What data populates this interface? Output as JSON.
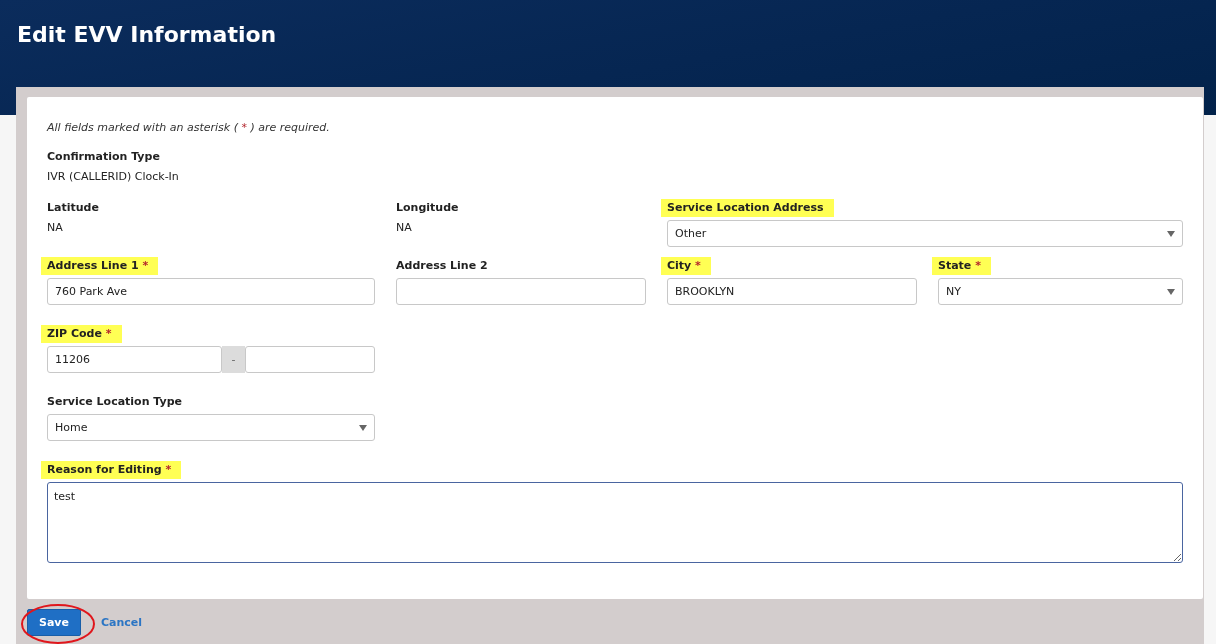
{
  "page": {
    "title": "Edit EVV Information"
  },
  "notice": {
    "before": "All fields marked with an asterisk ( ",
    "mark": "*",
    "after": " ) are required."
  },
  "rows": [
    [
      {
        "kind": "static",
        "label": "Confirmation Type",
        "value": "IVR (CALLERID) Clock-In",
        "highlighted": false
      }
    ],
    [
      {
        "kind": "static",
        "label": "Latitude",
        "value": "NA",
        "highlighted": false
      },
      {
        "kind": "static",
        "label": "Longitude",
        "value": "NA",
        "highlighted": false
      },
      {
        "kind": "select",
        "label": "Service Location Address",
        "value": "Other",
        "highlighted": true
      }
    ],
    [
      {
        "kind": "text",
        "label": "Address Line 1",
        "required_mark": "*",
        "value": "760 Park Ave",
        "highlighted": true
      },
      {
        "kind": "text",
        "label": "Address Line 2",
        "highlighted": false
      },
      {
        "kind": "text",
        "label": "City",
        "required_mark": "*",
        "value": "BROOKLYN",
        "highlighted": true
      },
      {
        "kind": "select",
        "label": "State",
        "required_mark": "*",
        "value": "NY",
        "highlighted": true
      }
    ],
    [
      {
        "kind": "zip",
        "label": "ZIP Code",
        "required_mark": "*",
        "value": "11206",
        "separator": "-",
        "highlighted": true
      }
    ],
    [
      {
        "kind": "select",
        "label": "Service Location Type",
        "value": "Home",
        "highlighted": false
      }
    ],
    [
      {
        "kind": "textarea",
        "label": "Reason for Editing",
        "required_mark": "*",
        "value": "test",
        "highlighted": true
      }
    ]
  ],
  "actions": {
    "save": {
      "label": "Save",
      "circled": true
    },
    "cancel": {
      "label": "Cancel"
    }
  }
}
